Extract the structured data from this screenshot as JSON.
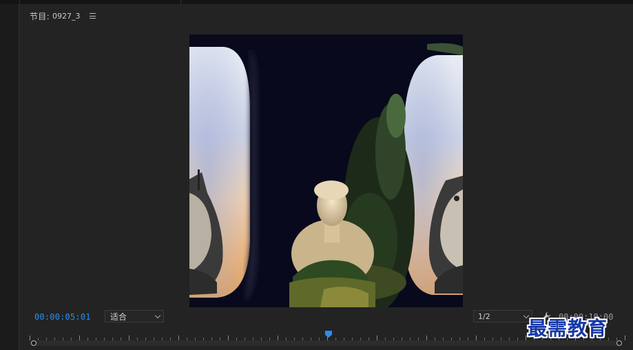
{
  "panel": {
    "title": "节目:",
    "sequence_name": "0927_3"
  },
  "controls": {
    "current_timecode": "00:00:05:01",
    "fit_label": "适合",
    "resolution_label": "1/2",
    "end_timecode": "00:00:10:00"
  },
  "playhead": {
    "position_fraction": 0.502
  },
  "watermark": {
    "text": "最需教育"
  },
  "colors": {
    "timecode": "#2e8ceb",
    "panel_bg": "#232323",
    "watermark": "#1537a8"
  },
  "icons": [
    "menu-icon",
    "chevron-down-icon",
    "wrench-icon",
    "playhead-icon"
  ]
}
